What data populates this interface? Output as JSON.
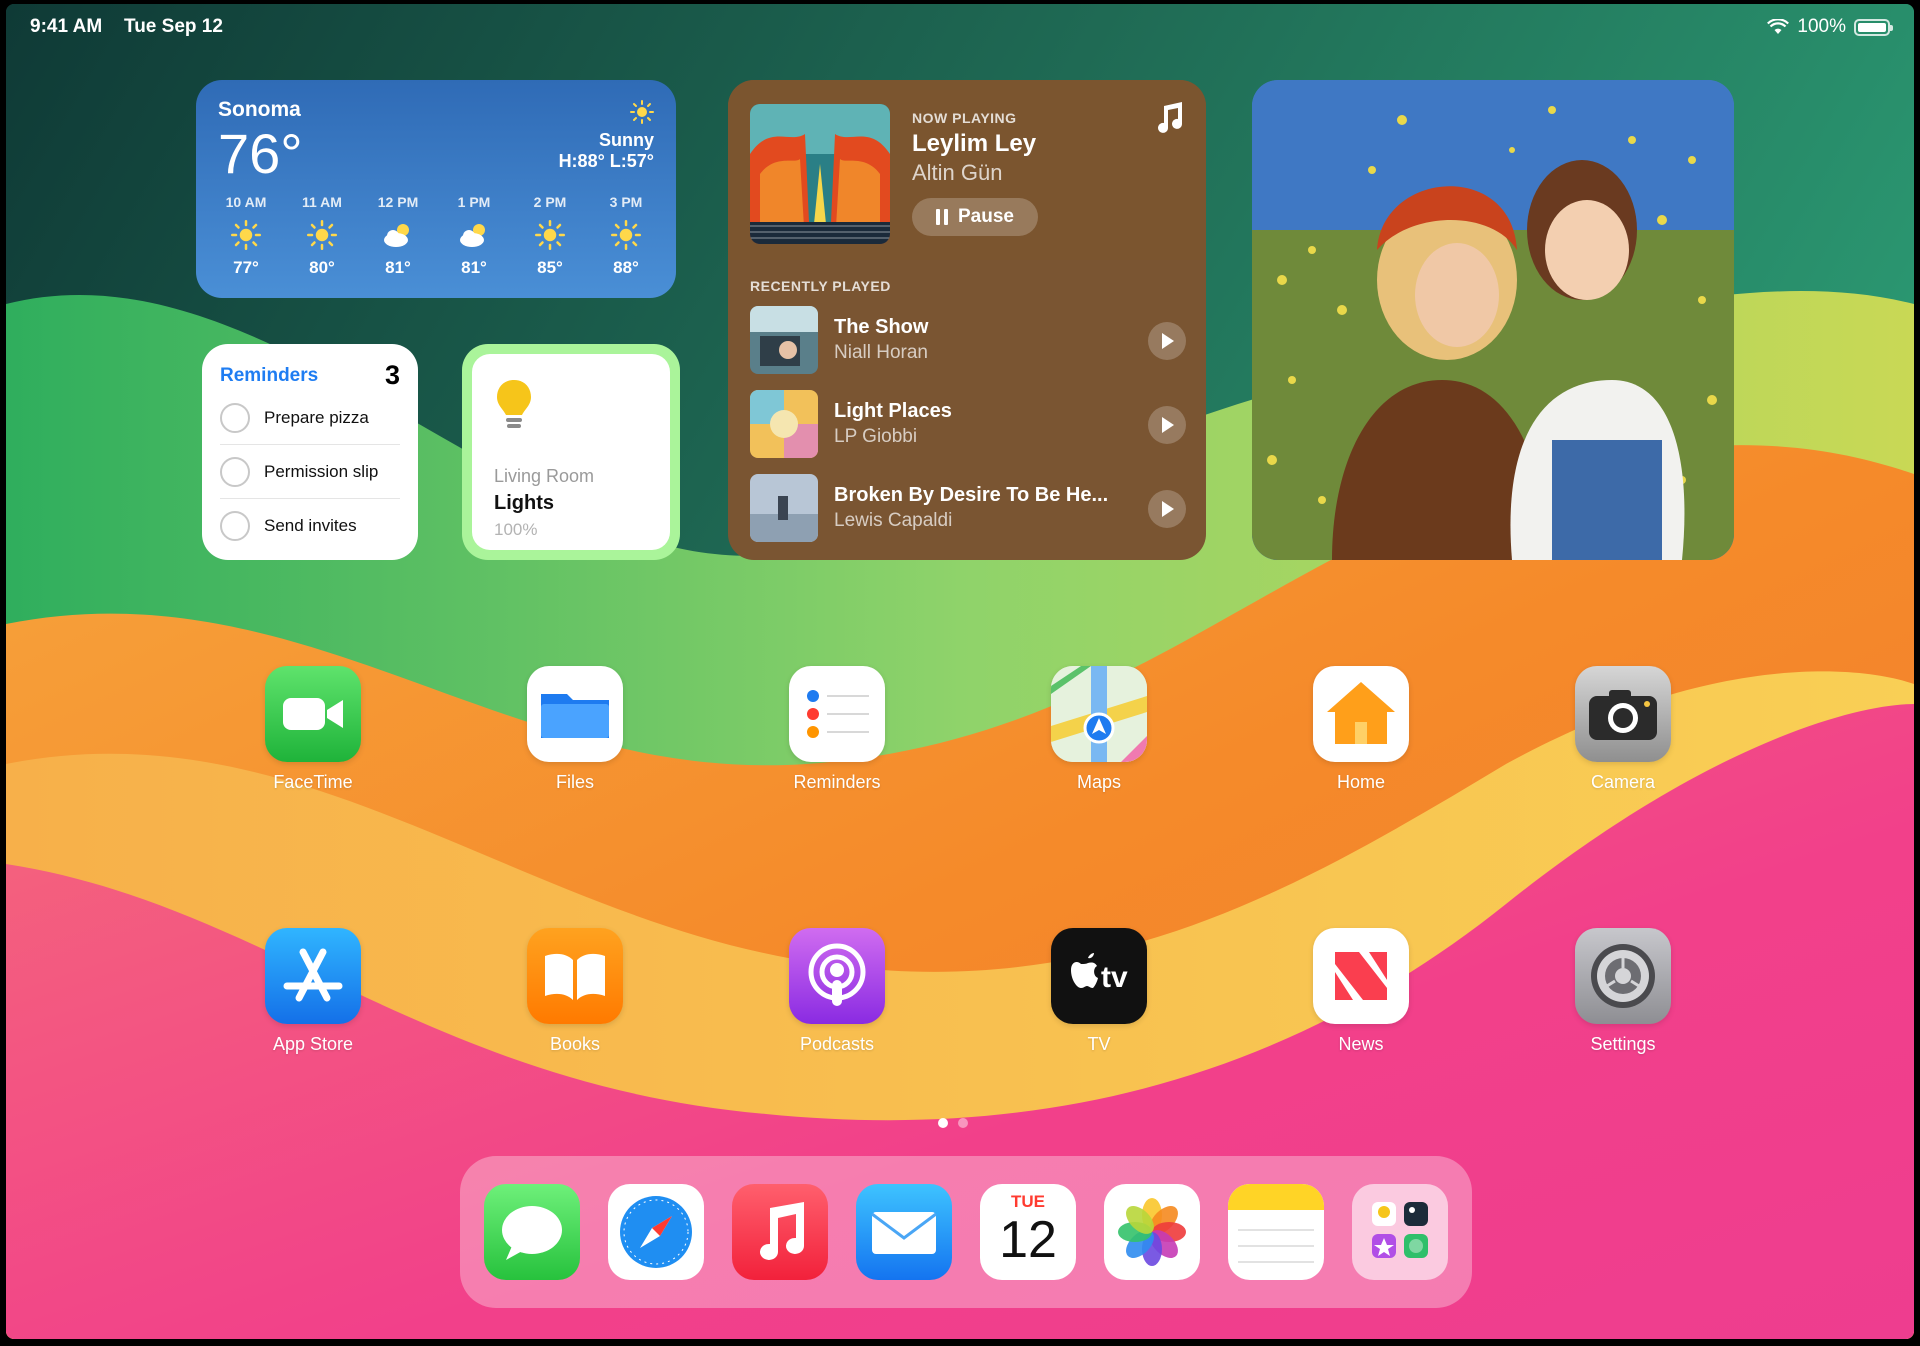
{
  "status_bar": {
    "time": "9:41 AM",
    "date": "Tue Sep 12",
    "battery": "100%"
  },
  "weather": {
    "city": "Sonoma",
    "temp": "76°",
    "condition": "Sunny",
    "hilo": "H:88° L:57°",
    "hours": [
      {
        "time": "10 AM",
        "icon": "sun-icon",
        "temp": "77°"
      },
      {
        "time": "11 AM",
        "icon": "sun-icon",
        "temp": "80°"
      },
      {
        "time": "12 PM",
        "icon": "partly-cloudy-icon",
        "temp": "81°"
      },
      {
        "time": "1 PM",
        "icon": "partly-cloudy-icon",
        "temp": "81°"
      },
      {
        "time": "2 PM",
        "icon": "sun-icon",
        "temp": "85°"
      },
      {
        "time": "3 PM",
        "icon": "sun-icon",
        "temp": "88°"
      }
    ]
  },
  "reminders": {
    "title": "Reminders",
    "count": "3",
    "items": [
      "Prepare pizza",
      "Permission slip",
      "Send invites"
    ]
  },
  "home": {
    "room": "Living Room",
    "device": "Lights",
    "level": "100%",
    "icon": "lightbulb-icon"
  },
  "music": {
    "now_playing_label": "NOW PLAYING",
    "title": "Leylim Ley",
    "artist": "Altin Gün",
    "pause_label": "Pause",
    "recently_played_label": "RECENTLY PLAYED",
    "recent": [
      {
        "title": "The Show",
        "artist": "Niall Horan"
      },
      {
        "title": "Light Places",
        "artist": "LP Giobbi"
      },
      {
        "title": "Broken By Desire To Be He...",
        "artist": "Lewis Capaldi"
      }
    ]
  },
  "apps_row1": [
    "FaceTime",
    "Files",
    "Reminders",
    "Maps",
    "Home",
    "Camera"
  ],
  "apps_row2": [
    "App Store",
    "Books",
    "Podcasts",
    "TV",
    "News",
    "Settings"
  ],
  "tv_icon_text": "tv",
  "dock": {
    "apps": [
      "messages-icon",
      "safari-icon",
      "music-icon",
      "mail-icon",
      "calendar-icon",
      "photos-icon",
      "notes-icon",
      "folder-icon"
    ],
    "calendar_day": "TUE",
    "calendar_date": "12"
  },
  "colors": {
    "accent_blue": "#1f7df2",
    "music_bg": "#7a5532",
    "home_green": "#aaf49a"
  }
}
